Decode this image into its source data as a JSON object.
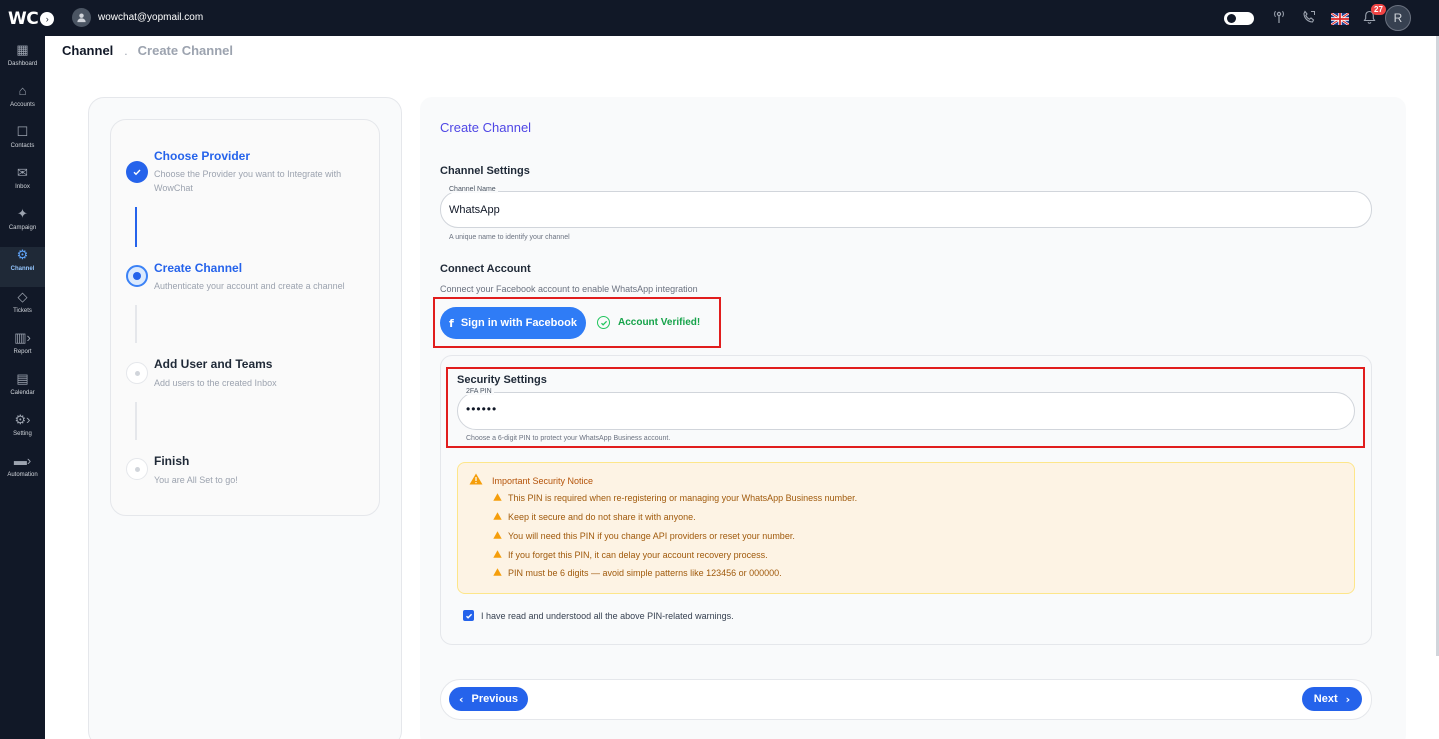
{
  "app": {
    "logo_text": "WC",
    "logo_toggle": "›",
    "user_email": "wowchat@yopmail.com",
    "notification_count": "27",
    "avatar_initial": "R"
  },
  "sidebar": {
    "items": [
      {
        "label": "Dashboard",
        "icon": "dashboard-icon",
        "glyph": "▦"
      },
      {
        "label": "Accounts",
        "icon": "home-icon",
        "glyph": "⌂"
      },
      {
        "label": "Contacts",
        "icon": "contacts-icon",
        "glyph": "☐"
      },
      {
        "label": "Inbox",
        "icon": "inbox-icon",
        "glyph": "✉"
      },
      {
        "label": "Campaign",
        "icon": "campaign-icon",
        "glyph": "✦"
      },
      {
        "label": "Channel",
        "icon": "channel-icon",
        "glyph": "⚙"
      },
      {
        "label": "Tickets",
        "icon": "ticket-icon",
        "glyph": "◇"
      },
      {
        "label": "Report",
        "icon": "report-icon",
        "glyph": "▥›"
      },
      {
        "label": "Calendar",
        "icon": "calendar-icon",
        "glyph": "▤"
      },
      {
        "label": "Setting",
        "icon": "gear-icon",
        "glyph": "⚙›"
      },
      {
        "label": "Automation",
        "icon": "automation-icon",
        "glyph": "▬›"
      }
    ],
    "active_index": 5
  },
  "breadcrumb": {
    "first": "Channel",
    "separator": ".",
    "second": "Create Channel"
  },
  "stepper": {
    "steps": [
      {
        "title": "Choose Provider",
        "desc": "Choose the Provider you want to Integrate with WowChat",
        "state": "done"
      },
      {
        "title": "Create Channel",
        "desc": "Authenticate your account and create a channel",
        "state": "active"
      },
      {
        "title": "Add User and Teams",
        "desc": "Add users to the created Inbox",
        "state": "todo"
      },
      {
        "title": "Finish",
        "desc": "You are All Set to go!",
        "state": "todo"
      }
    ]
  },
  "form": {
    "title": "Create Channel",
    "channel_settings_heading": "Channel Settings",
    "channel_name_label": "Channel Name",
    "channel_name_value": "WhatsApp",
    "channel_name_hint": "A unique name to identify your channel",
    "connect_heading": "Connect Account",
    "connect_sub": "Connect your Facebook account to enable WhatsApp integration",
    "fb_button": "Sign in with Facebook",
    "verified_text": "Account Verified!",
    "security_heading": "Security Settings",
    "pin_label": "2FA PIN",
    "pin_value": "••••••",
    "pin_hint": "Choose a 6-digit PIN to protect your WhatsApp Business account.",
    "notice_title": "Important Security Notice",
    "notice_items": [
      "This PIN is required when re-registering or managing your WhatsApp Business number.",
      "Keep it secure and do not share it with anyone.",
      "You will need this PIN if you change API providers or reset your number.",
      "If you forget this PIN, it can delay your account recovery process.",
      "PIN must be 6 digits — avoid simple patterns like 123456 or 000000."
    ],
    "ack_text": "I have read and understood all the above PIN-related warnings.",
    "ack_checked": true,
    "prev_button": "Previous",
    "next_button": "Next"
  },
  "colors": {
    "sidebar_bg": "#111827",
    "accent": "#2563eb",
    "verified": "#16a34a",
    "highlight_box": "#e11d1d",
    "warning": "#f59e0b"
  }
}
